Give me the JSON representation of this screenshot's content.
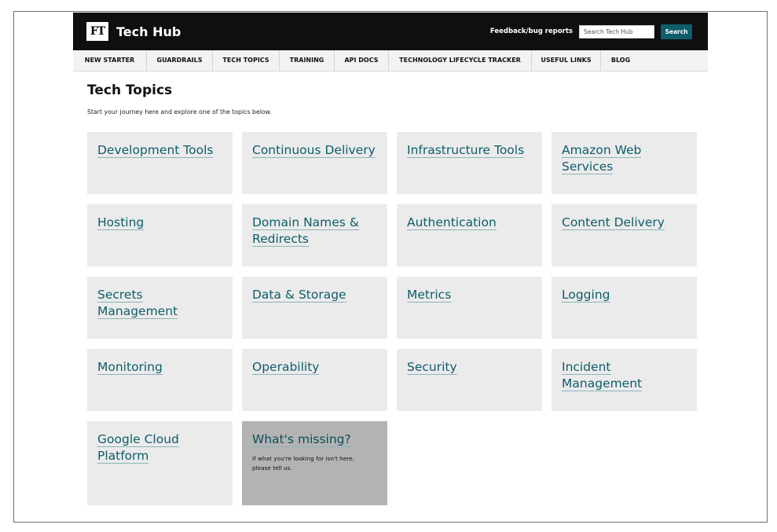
{
  "header": {
    "logo_text": "FT",
    "site_title": "Tech Hub",
    "feedback_label": "Feedback/bug reports",
    "search_placeholder": "Search Tech Hub",
    "search_button_label": "Search"
  },
  "nav": {
    "items": [
      {
        "label": "NEW STARTER"
      },
      {
        "label": "GUARDRAILS"
      },
      {
        "label": "TECH TOPICS"
      },
      {
        "label": "TRAINING"
      },
      {
        "label": "API DOCS"
      },
      {
        "label": "TECHNOLOGY LIFECYCLE TRACKER"
      },
      {
        "label": "USEFUL LINKS"
      },
      {
        "label": "BLOG"
      }
    ]
  },
  "main": {
    "title": "Tech Topics",
    "intro": "Start your journey here and explore one of the topics below.",
    "topics": [
      {
        "label": "Development Tools"
      },
      {
        "label": "Continuous Delivery"
      },
      {
        "label": "Infrastructure Tools"
      },
      {
        "label": "Amazon Web Services"
      },
      {
        "label": "Hosting"
      },
      {
        "label": "Domain Names & Redirects"
      },
      {
        "label": "Authentication"
      },
      {
        "label": "Content Delivery"
      },
      {
        "label": "Secrets Management"
      },
      {
        "label": "Data & Storage"
      },
      {
        "label": "Metrics"
      },
      {
        "label": "Logging"
      },
      {
        "label": "Monitoring"
      },
      {
        "label": "Operability"
      },
      {
        "label": "Security"
      },
      {
        "label": "Incident Management"
      },
      {
        "label": "Google Cloud Platform"
      }
    ],
    "missing": {
      "title": "What's missing?",
      "text": "If what you're looking for isn't here, please tell us."
    }
  },
  "colors": {
    "header_bg": "#0f0f0f",
    "accent": "#0d5d6b",
    "card_bg": "#ebebeb",
    "missing_card_bg": "#b3b3b3",
    "nav_bg": "#f2f2f2"
  }
}
